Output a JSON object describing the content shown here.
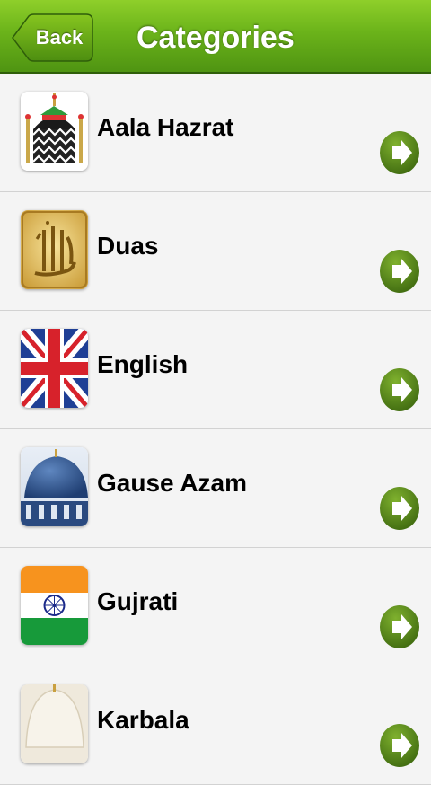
{
  "navbar": {
    "back_label": "Back",
    "title": "Categories"
  },
  "colors": {
    "nav_green": "#6bb31a",
    "chevron_green": "#4a7a14"
  },
  "categories": [
    {
      "label": "Aala Hazrat",
      "icon": "dome-shrine-icon"
    },
    {
      "label": "Duas",
      "icon": "allah-calligraphy-icon"
    },
    {
      "label": "English",
      "icon": "uk-flag-icon"
    },
    {
      "label": "Gause Azam",
      "icon": "blue-dome-icon"
    },
    {
      "label": "Gujrati",
      "icon": "india-flag-icon"
    },
    {
      "label": "Karbala",
      "icon": "white-dome-icon"
    }
  ]
}
